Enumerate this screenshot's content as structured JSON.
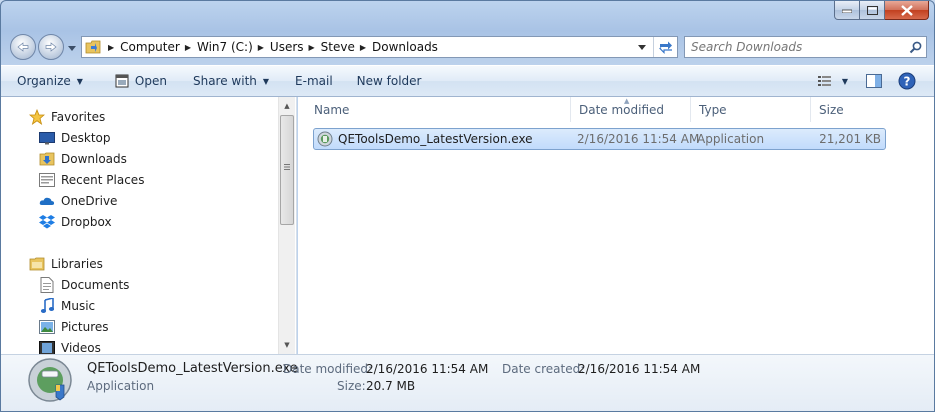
{
  "window": {
    "caption_buttons": {
      "minimize": "minimize-icon",
      "maximize": "maximize-icon",
      "close": "close-icon"
    }
  },
  "address_bar": {
    "breadcrumbs": [
      "Computer",
      "Win7 (C:)",
      "Users",
      "Steve",
      "Downloads"
    ],
    "search_placeholder": "Search Downloads"
  },
  "toolbar": {
    "organize": "Organize",
    "open": "Open",
    "share_with": "Share with",
    "email": "E-mail",
    "new_folder": "New folder"
  },
  "nav_pane": {
    "favorites_header": "Favorites",
    "favorites": [
      "Desktop",
      "Downloads",
      "Recent Places",
      "OneDrive",
      "Dropbox"
    ],
    "libraries_header": "Libraries",
    "libraries": [
      "Documents",
      "Music",
      "Pictures",
      "Videos"
    ]
  },
  "columns": [
    "Name",
    "Date modified",
    "Type",
    "Size"
  ],
  "files": [
    {
      "name": "QEToolsDemo_LatestVersion.exe",
      "date_modified": "2/16/2016 11:54 AM",
      "type": "Application",
      "size": "21,201 KB",
      "selected": true
    }
  ],
  "details": {
    "file_name": "QEToolsDemo_LatestVersion.exe",
    "file_type": "Application",
    "date_modified_label": "Date modified:",
    "date_modified": "2/16/2016 11:54 AM",
    "date_created_label": "Date created:",
    "date_created": "2/16/2016 11:54 AM",
    "size_label": "Size:",
    "size": "20.7 MB"
  },
  "colors": {
    "selection_fill": "#c1dbfc",
    "selection_border": "#7da2ce",
    "toolbar_text": "#1e395b",
    "column_header_text": "#4c607a"
  }
}
